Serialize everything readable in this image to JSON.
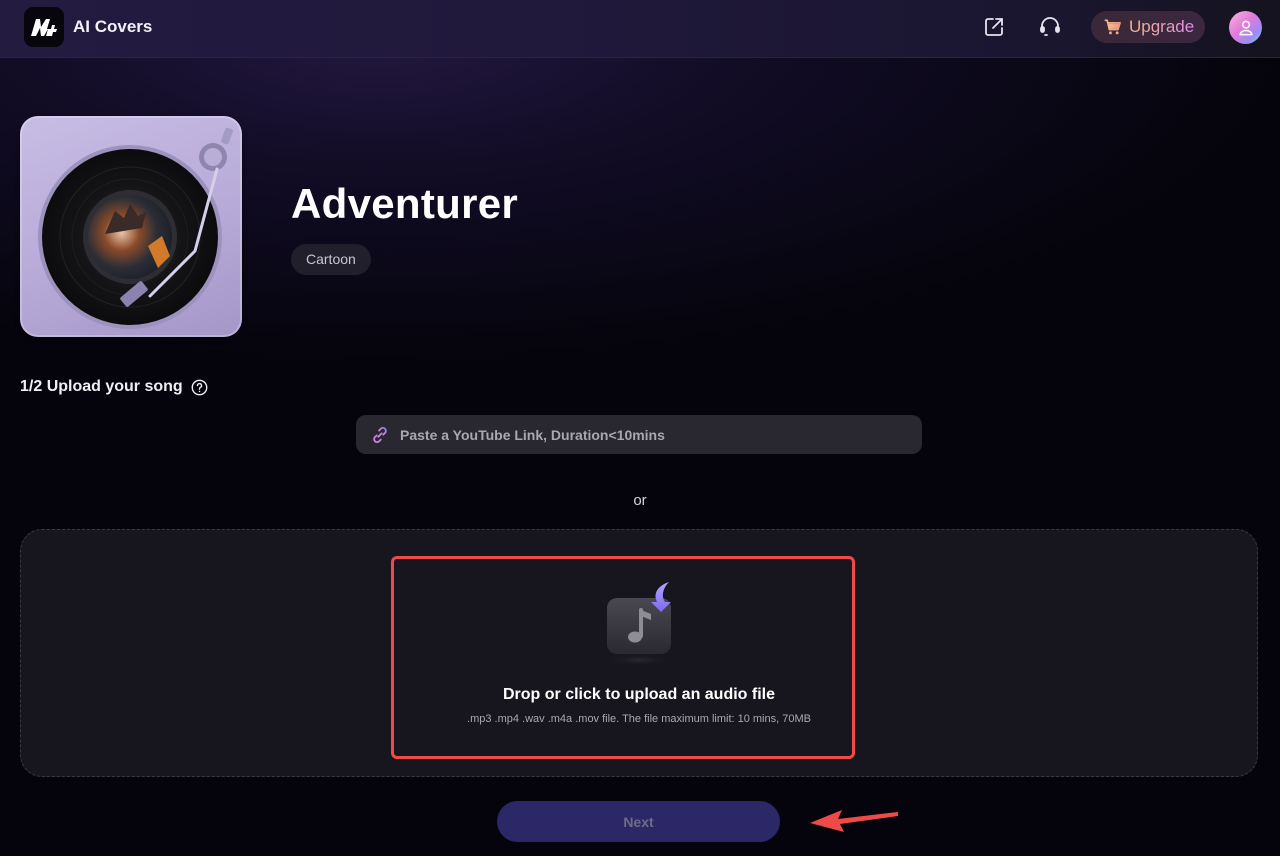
{
  "header": {
    "app_title": "AI Covers",
    "logo_icon": "media-io-logo",
    "share_icon": "external-link-icon",
    "support_icon": "headset-icon",
    "upgrade_label": "Upgrade",
    "upgrade_icon": "cart-icon",
    "avatar_icon": "user-avatar-icon"
  },
  "voice": {
    "title": "Adventurer",
    "tag": "Cartoon",
    "cover_icon": "vinyl-turntable-cover"
  },
  "upload": {
    "step_label": "1/2 Upload your song",
    "help_icon": "question-circle-icon",
    "youtube_placeholder": "Paste a YouTube Link, Duration<10mins",
    "youtube_value": "",
    "link_icon": "link-icon",
    "or_label": "or",
    "drop_title": "Drop or click to upload an audio file",
    "drop_subtitle": ".mp3 .mp4 .wav .m4a .mov file. The file maximum limit: 10 mins, 70MB",
    "drop_icon": "music-file-upload-icon"
  },
  "actions": {
    "next_label": "Next",
    "next_enabled": false
  },
  "annotations": {
    "highlight_color": "#ef4a48",
    "arrow_color": "#ef4a48"
  },
  "colors": {
    "background": "#05040c",
    "header": "#231b40",
    "next_button": "#2c2766",
    "input_bg": "#29272f"
  }
}
